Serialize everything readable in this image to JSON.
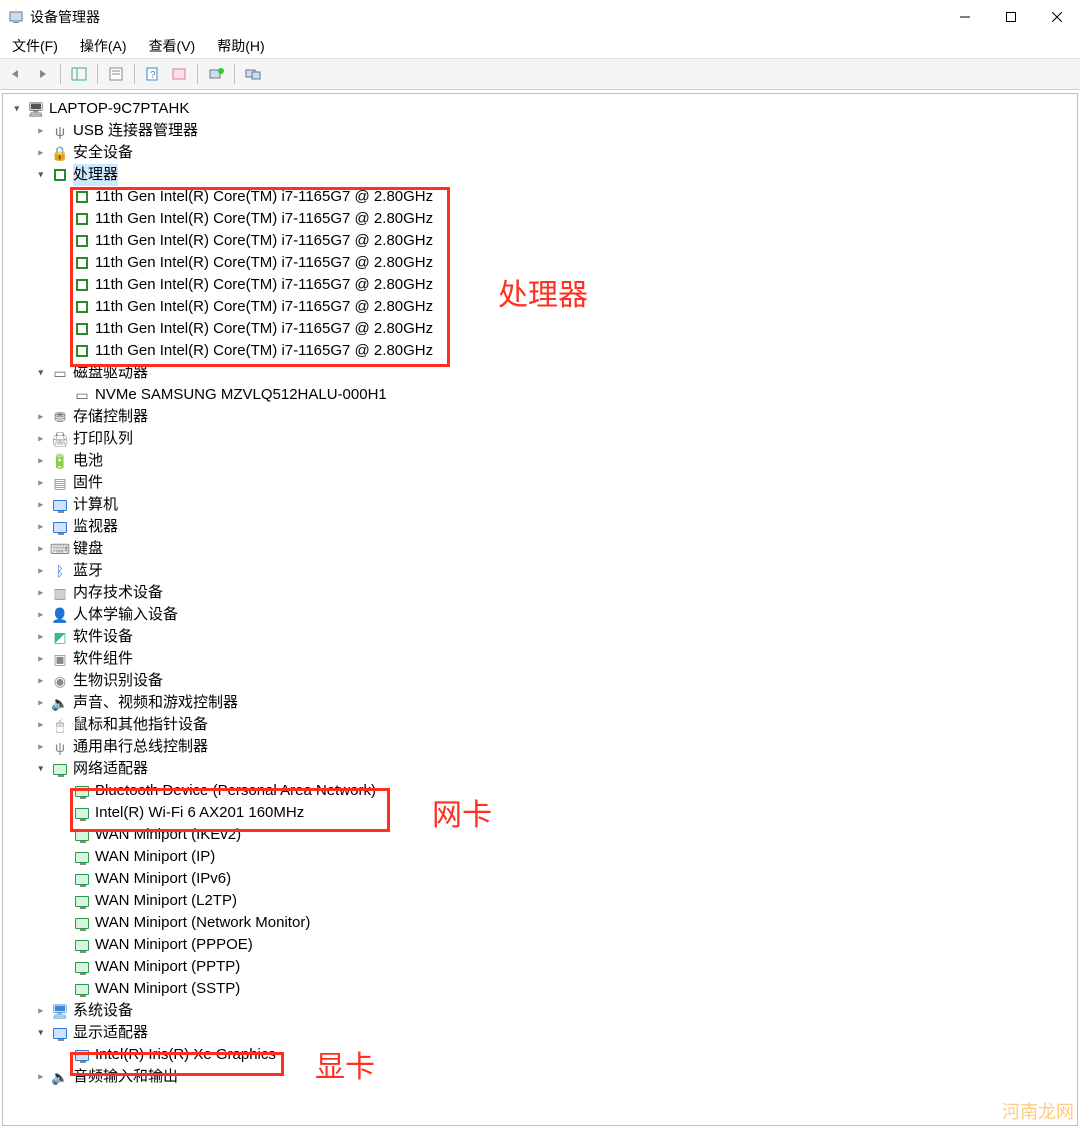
{
  "window": {
    "title": "设备管理器"
  },
  "menubar": {
    "file": "文件(F)",
    "action": "操作(A)",
    "view": "查看(V)",
    "help": "帮助(H)"
  },
  "tree": {
    "root": "LAPTOP-9C7PTAHK",
    "usb_connector": "USB 连接器管理器",
    "security": "安全设备",
    "processors": {
      "label": "处理器",
      "items": [
        "11th Gen Intel(R) Core(TM) i7-1165G7 @ 2.80GHz",
        "11th Gen Intel(R) Core(TM) i7-1165G7 @ 2.80GHz",
        "11th Gen Intel(R) Core(TM) i7-1165G7 @ 2.80GHz",
        "11th Gen Intel(R) Core(TM) i7-1165G7 @ 2.80GHz",
        "11th Gen Intel(R) Core(TM) i7-1165G7 @ 2.80GHz",
        "11th Gen Intel(R) Core(TM) i7-1165G7 @ 2.80GHz",
        "11th Gen Intel(R) Core(TM) i7-1165G7 @ 2.80GHz",
        "11th Gen Intel(R) Core(TM) i7-1165G7 @ 2.80GHz"
      ]
    },
    "disk": {
      "label": "磁盘驱动器",
      "items": [
        "NVMe SAMSUNG MZVLQ512HALU-000H1"
      ]
    },
    "storage_ctrl": "存储控制器",
    "print_queue": "打印队列",
    "battery": "电池",
    "firmware": "固件",
    "computer": "计算机",
    "monitor": "监视器",
    "keyboard": "键盘",
    "bluetooth": "蓝牙",
    "memory_tech": "内存技术设备",
    "hid": "人体学输入设备",
    "software_dev": "软件设备",
    "software_comp": "软件组件",
    "biometric": "生物识别设备",
    "sound": "声音、视频和游戏控制器",
    "mouse": "鼠标和其他指针设备",
    "usb_ctrl": "通用串行总线控制器",
    "network": {
      "label": "网络适配器",
      "items": [
        "Bluetooth Device (Personal Area Network)",
        "Intel(R) Wi-Fi 6 AX201 160MHz",
        "WAN Miniport (IKEv2)",
        "WAN Miniport (IP)",
        "WAN Miniport (IPv6)",
        "WAN Miniport (L2TP)",
        "WAN Miniport (Network Monitor)",
        "WAN Miniport (PPPOE)",
        "WAN Miniport (PPTP)",
        "WAN Miniport (SSTP)"
      ]
    },
    "system": "系统设备",
    "display": {
      "label": "显示适配器",
      "items": [
        "Intel(R) Iris(R) Xe Graphics"
      ]
    },
    "audio_io": "音频输入和输出"
  },
  "annotations": {
    "cpu": "处理器",
    "nic": "网卡",
    "gpu": "显卡"
  },
  "watermark": "河南龙网"
}
